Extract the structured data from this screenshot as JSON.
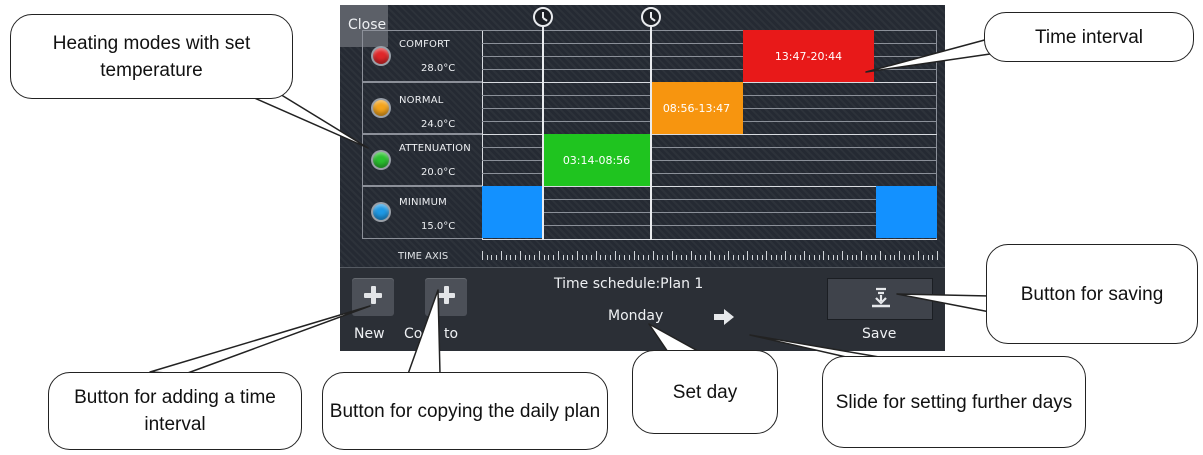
{
  "screen": {
    "close_label": "Close",
    "modes": [
      {
        "name": "COMFORT",
        "temp": "28.0°C",
        "color": "#e0272a"
      },
      {
        "name": "NORMAL",
        "temp": "24.0°C",
        "color": "#f4a41c"
      },
      {
        "name": "ATTENUATION",
        "temp": "20.0°C",
        "color": "#2bc230"
      },
      {
        "name": "MINIMUM",
        "temp": "15.0°C",
        "color": "#1f9ae6"
      }
    ],
    "intervals": [
      {
        "label": "13:47-20:44",
        "mode": "COMFORT",
        "color": "#e81919"
      },
      {
        "label": "08:56-13:47",
        "mode": "NORMAL",
        "color": "#f7950f"
      },
      {
        "label": "03:14-08:56",
        "mode": "ATTENUATION",
        "color": "#1fc41f"
      },
      {
        "label": "",
        "mode": "MINIMUM",
        "color": "#1391ff"
      },
      {
        "label": "",
        "mode": "MINIMUM",
        "color": "#1391ff"
      }
    ],
    "time_axis_label": "TIME AXIS",
    "schedule_title": "Time schedule:Plan 1",
    "day": "Monday",
    "new_label": "New",
    "copy_label": "Copy to",
    "save_label": "Save",
    "icons": {
      "clock": "clock-icon",
      "plus": "plus-icon",
      "arrow": "arrow-right-icon",
      "save": "download-save-icon"
    }
  },
  "annotations": {
    "heating_modes": "Heating modes with set temperature",
    "time_interval": "Time interval",
    "save_button": "Button for saving",
    "add_interval": "Button for adding a time interval",
    "copy_plan": "Button for copying the daily plan",
    "set_day": "Set day",
    "slide_days": "Slide for setting further days"
  }
}
